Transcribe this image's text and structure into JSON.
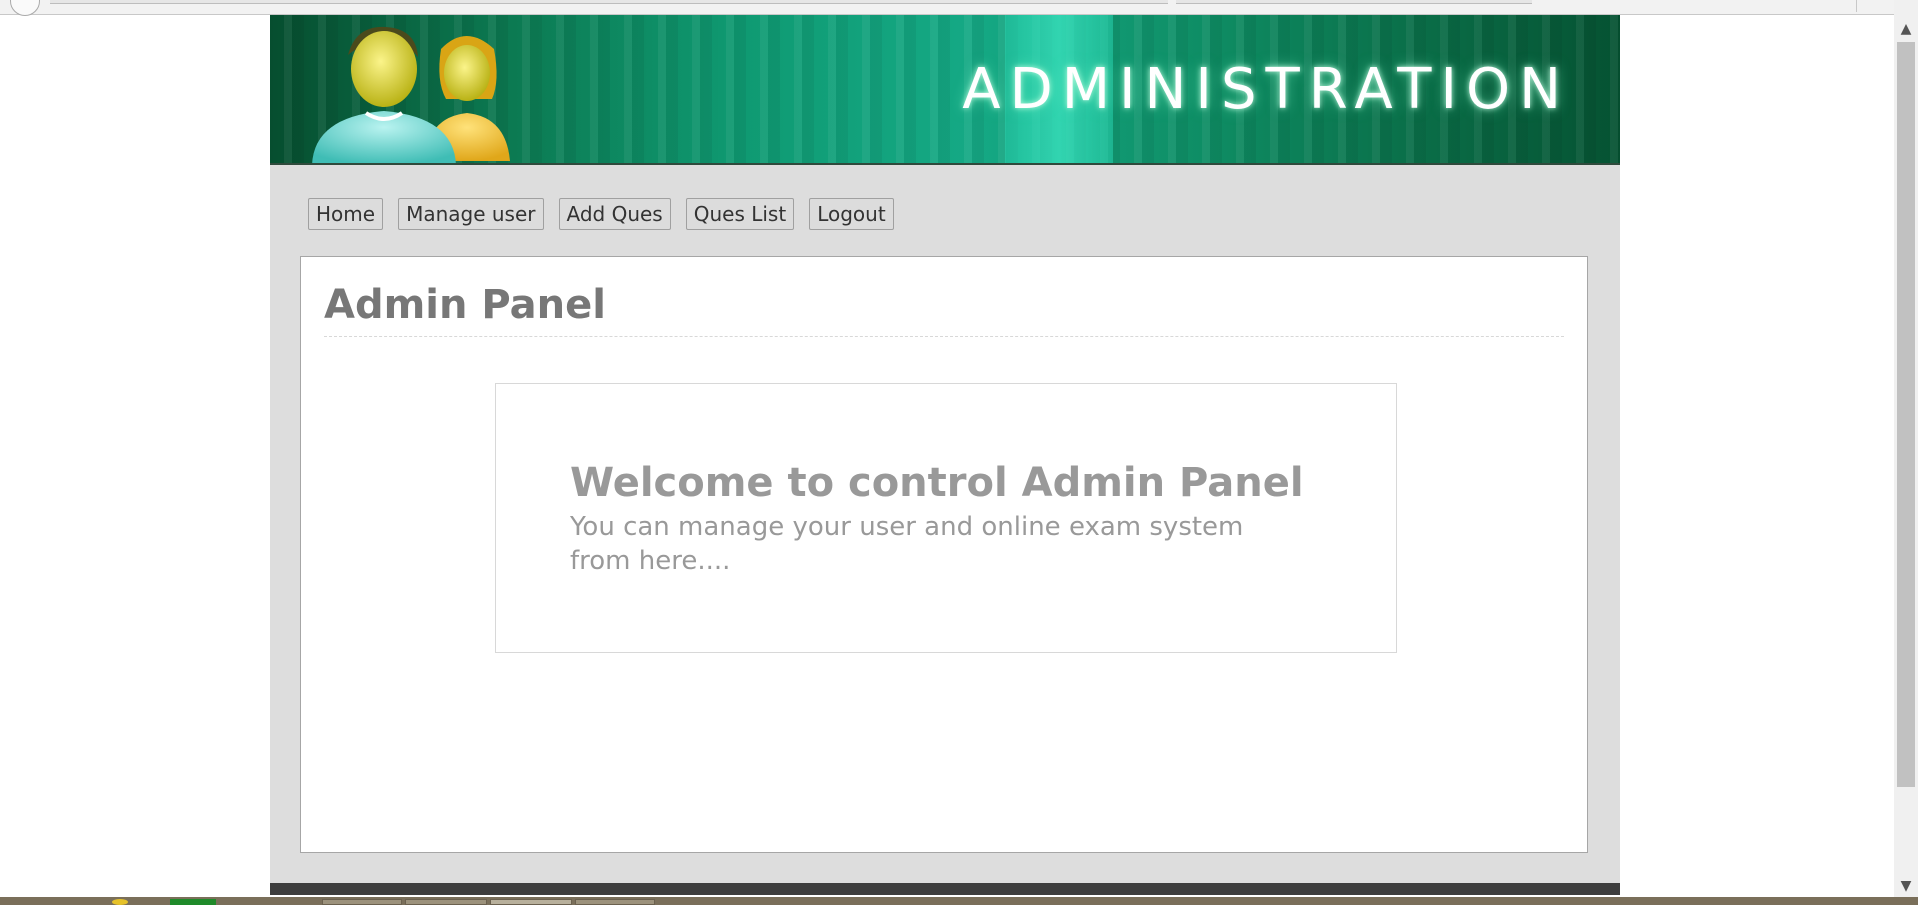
{
  "banner": {
    "title": "ADMINISTRATION"
  },
  "nav": {
    "items": [
      {
        "label": "Home"
      },
      {
        "label": "Manage user"
      },
      {
        "label": "Add Ques"
      },
      {
        "label": "Ques List"
      },
      {
        "label": "Logout"
      }
    ]
  },
  "main": {
    "title": "Admin Panel",
    "welcome": {
      "heading": "Welcome to control Admin Panel",
      "text": "You can manage your user and online exam system from here...."
    }
  },
  "scrollbar": {
    "up_icon": "▲",
    "down_icon": "▼"
  },
  "colors": {
    "banner_green": "#0c7a52",
    "page_background": "#dddddd",
    "heading_gray": "#777777"
  }
}
